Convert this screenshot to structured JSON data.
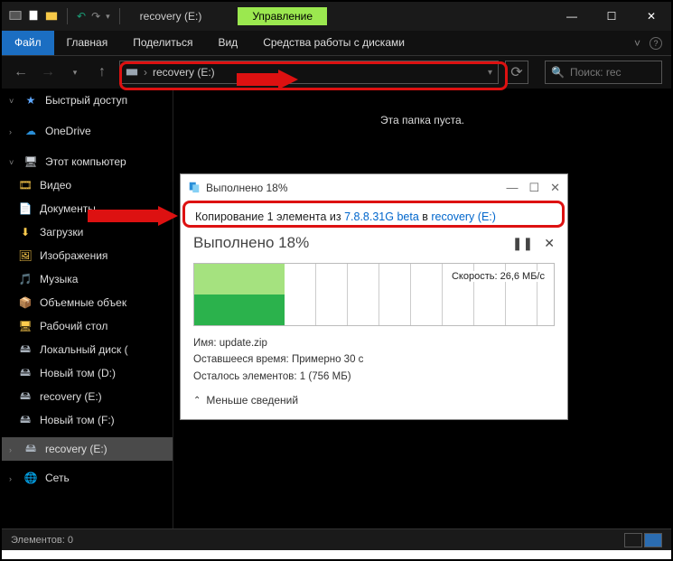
{
  "titlebar": {
    "app_title": "recovery (E:)",
    "ribbon_context": "Управление"
  },
  "ribbon": {
    "file": "Файл",
    "tabs": [
      "Главная",
      "Поделиться",
      "Вид",
      "Средства работы с дисками"
    ]
  },
  "nav": {
    "breadcrumb_sep": "›",
    "breadcrumb": "recovery (E:)",
    "search_placeholder": "Поиск: rec"
  },
  "sidebar": {
    "quick_access": "Быстрый доступ",
    "onedrive": "OneDrive",
    "this_pc": "Этот компьютер",
    "items": [
      "Видео",
      "Документы",
      "Загрузки",
      "Изображения",
      "Музыка",
      "Объемные объек",
      "Рабочий стол",
      "Локальный диск (",
      "Новый том (D:)",
      "recovery (E:)",
      "Новый том (F:)"
    ],
    "selected": "recovery (E:)",
    "network": "Сеть"
  },
  "content": {
    "empty": "Эта папка пуста."
  },
  "dialog": {
    "title": "Выполнено 18%",
    "copy_prefix": "Копирование 1 элемента из ",
    "copy_src": "7.8.8.31G beta",
    "copy_mid": " в ",
    "copy_dst": "recovery (E:)",
    "status_big": "Выполнено 18%",
    "speed_label": "Скорость: 26,6 МБ/с",
    "name_label": "Имя:  update.zip",
    "time_label": "Оставшееся время: Примерно 30 с",
    "remain_label": "Осталось элементов: 1 (756 МБ)",
    "fewer": "Меньше сведений",
    "pause_glyph": "❚❚",
    "close_glyph": "✕"
  },
  "statusbar": {
    "count": "Элементов: 0"
  }
}
